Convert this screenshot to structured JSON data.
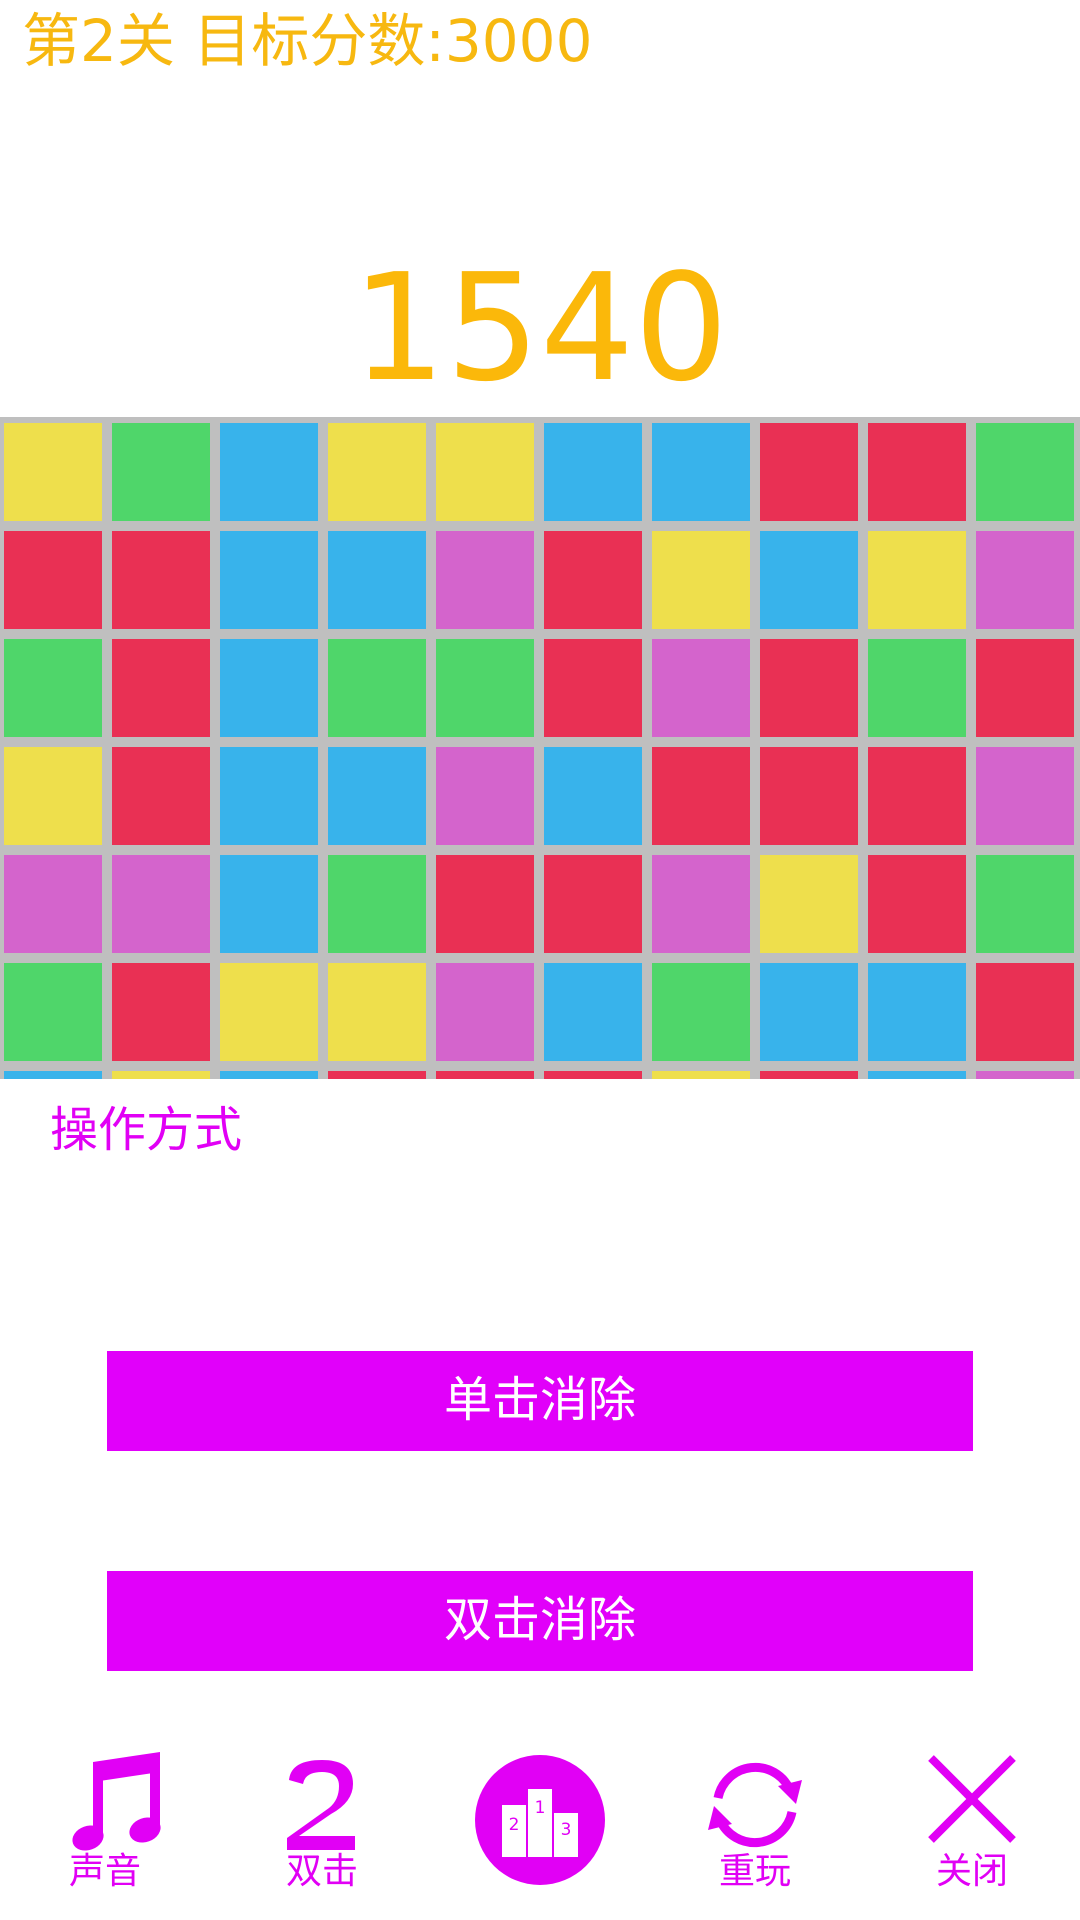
{
  "header": {
    "level_title": "第2关 目标分数:3000"
  },
  "score": "1540",
  "board": {
    "colors": {
      "Y": "#EEDF4C",
      "G": "#4FD66A",
      "B": "#38B3EB",
      "R": "#E93054",
      "P": "#D464CC"
    },
    "rows": [
      [
        "Y",
        "G",
        "B",
        "Y",
        "Y",
        "B",
        "B",
        "R",
        "R",
        "G"
      ],
      [
        "R",
        "R",
        "B",
        "B",
        "P",
        "R",
        "Y",
        "B",
        "Y",
        "P"
      ],
      [
        "G",
        "R",
        "B",
        "G",
        "G",
        "R",
        "P",
        "R",
        "G",
        "R"
      ],
      [
        "Y",
        "R",
        "B",
        "B",
        "P",
        "B",
        "R",
        "R",
        "R",
        "P"
      ],
      [
        "P",
        "P",
        "B",
        "G",
        "R",
        "R",
        "P",
        "Y",
        "R",
        "G"
      ],
      [
        "G",
        "R",
        "Y",
        "Y",
        "P",
        "B",
        "G",
        "B",
        "B",
        "R"
      ],
      [
        "B",
        "Y",
        "B",
        "R",
        "R",
        "R",
        "Y",
        "R",
        "B",
        "P"
      ]
    ]
  },
  "controls": {
    "section_label": "操作方式",
    "single_click_label": "单击消除",
    "double_click_label": "双击消除"
  },
  "bottom_nav": {
    "sound_label": "声音",
    "sound_icon": "music-note-icon",
    "double_label": "双击",
    "double_icon": "digit-2-icon",
    "rank_icon": "podium-icon",
    "rank_numbers": [
      "2",
      "1",
      "3"
    ],
    "replay_label": "重玩",
    "replay_icon": "refresh-icon",
    "close_label": "关闭",
    "close_icon": "close-icon"
  },
  "accent_color": "#E100F5",
  "score_color": "#FBB80A"
}
